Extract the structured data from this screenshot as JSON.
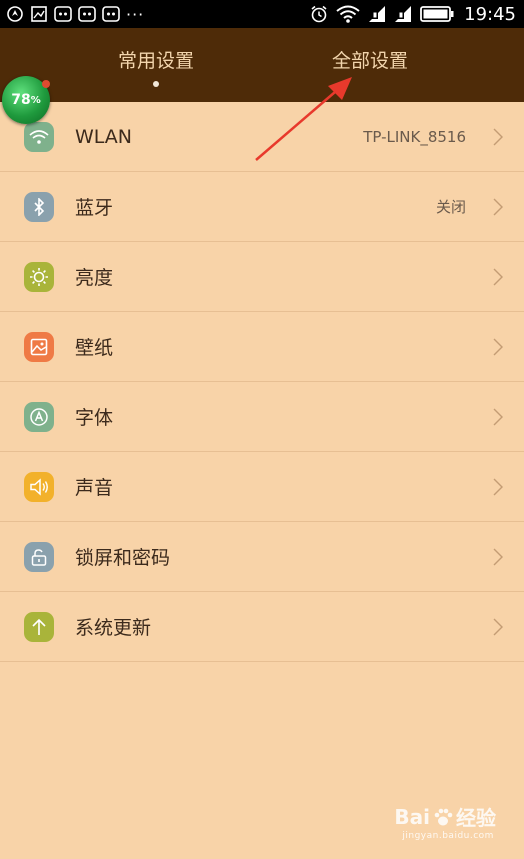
{
  "status_bar": {
    "time": "19:45",
    "more": "···",
    "left_icons": [
      "navigation-icon",
      "gallery-icon",
      "app-notification-icon",
      "app-notification-icon",
      "app-notification-icon"
    ],
    "right_icons": [
      "alarm-icon",
      "wifi-icon",
      "sim1-icon",
      "sim2-icon",
      "battery-icon"
    ]
  },
  "tabs": [
    {
      "label": "常用设置",
      "selected": true
    },
    {
      "label": "全部设置",
      "selected": false
    }
  ],
  "floating_badge": {
    "value": "78",
    "unit": "%"
  },
  "settings": [
    {
      "label": "WLAN",
      "value": "TP-LINK_8516",
      "icon": "wifi-icon",
      "color": "#7fb18c"
    },
    {
      "label": "蓝牙",
      "value": "关闭",
      "icon": "bluetooth-icon",
      "color": "#8aa1ad"
    },
    {
      "label": "亮度",
      "value": "",
      "icon": "brightness-icon",
      "color": "#a9b43a"
    },
    {
      "label": "壁纸",
      "value": "",
      "icon": "wallpaper-icon",
      "color": "#ef7a45"
    },
    {
      "label": "字体",
      "value": "",
      "icon": "font-icon",
      "color": "#7fb18c"
    },
    {
      "label": "声音",
      "value": "",
      "icon": "sound-icon",
      "color": "#f2b12b"
    },
    {
      "label": "锁屏和密码",
      "value": "",
      "icon": "lock-icon",
      "color": "#8aa1ad"
    },
    {
      "label": "系统更新",
      "value": "",
      "icon": "update-icon",
      "color": "#a9b43a"
    }
  ],
  "watermark": {
    "brand": "Bai",
    "brand_suffix": "经验",
    "url": "jingyan.baidu.com"
  },
  "colors": {
    "header": "#4e2b08",
    "background": "#f8d3a8",
    "annotation_arrow": "#e8392c"
  }
}
